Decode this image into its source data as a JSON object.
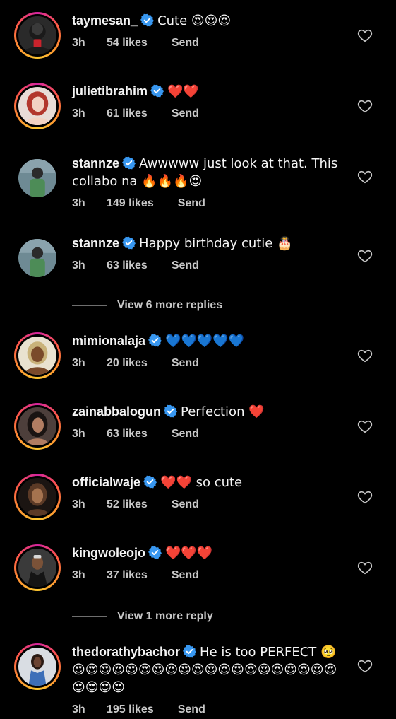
{
  "comments": [
    {
      "username": "taymesan_",
      "text": "Cute 😍😍😍",
      "time": "3h",
      "likes": "54 likes",
      "send": "Send",
      "avatar_icon": "man-with-red-cup-avatar",
      "avatar_colors": [
        "#2a2a2a",
        "#c9232c",
        "#d8d8d8"
      ]
    },
    {
      "username": "julietibrahim",
      "text": "❤️❤️",
      "time": "3h",
      "likes": "61 likes",
      "send": "Send",
      "avatar_icon": "woman-with-red-hair-avatar",
      "avatar_colors": [
        "#e8dcd6",
        "#b2372c",
        "#f2d3c3"
      ]
    },
    {
      "username": "stannze",
      "text": "Awwwww just look at that. This collabo na 🔥🔥🔥😍",
      "time": "3h",
      "likes": "149 likes",
      "send": "Send",
      "avatar_icon": "man-in-green-shirt-avatar",
      "avatar_colors": [
        "#6e8a94",
        "#4d8c57",
        "#2b2b2b"
      ]
    },
    {
      "username": "stannze",
      "text": "Happy birthday cutie 🎂",
      "time": "3h",
      "likes": "63 likes",
      "send": "Send",
      "avatar_icon": "man-in-green-shirt-avatar",
      "avatar_colors": [
        "#6e8a94",
        "#4d8c57",
        "#2b2b2b"
      ]
    },
    {
      "username": "mimionalaja",
      "text": "💙💙💙💙💙",
      "time": "3h",
      "likes": "20 likes",
      "send": "Send",
      "avatar_icon": "woman-smiling-avatar",
      "avatar_colors": [
        "#c9b27a",
        "#7a4a2a",
        "#e9e2d0"
      ]
    },
    {
      "username": "zainabbalogun",
      "text": "Perfection ❤️",
      "time": "3h",
      "likes": "63 likes",
      "send": "Send",
      "avatar_icon": "woman-dark-hair-avatar",
      "avatar_colors": [
        "#4d3f3b",
        "#1a1412",
        "#b17d62"
      ]
    },
    {
      "username": "officialwaje",
      "text": "❤️❤️ so cute",
      "time": "3h",
      "likes": "52 likes",
      "send": "Send",
      "avatar_icon": "woman-dark-background-avatar",
      "avatar_colors": [
        "#1b1512",
        "#5b3a26",
        "#a5734f"
      ]
    },
    {
      "username": "kingwoleojo",
      "text": "❤️❤️❤️",
      "time": "3h",
      "likes": "37 likes",
      "send": "Send",
      "avatar_icon": "man-dark-suit-avatar",
      "avatar_colors": [
        "#3a3a3a",
        "#141414",
        "#7a5238"
      ]
    },
    {
      "username": "thedorathybachor",
      "text": "He is too PERFECT 🥺😍😍😍😍😍😍😍😍😍😍😍😍😍😍😍😍😍😍😍😍😍😍😍😍",
      "time": "3h",
      "likes": "195 likes",
      "send": "Send",
      "avatar_icon": "woman-blue-outfit-avatar",
      "avatar_colors": [
        "#d9dde3",
        "#3d6fb8",
        "#2a1a14"
      ]
    }
  ],
  "view_more": [
    {
      "label": "View 6 more replies"
    },
    {
      "label": "View 1 more reply"
    }
  ],
  "colors": {
    "background": "#000000",
    "text": "#f5f5f5",
    "secondary": "#c8c8c8",
    "verified": "#3897f0"
  }
}
